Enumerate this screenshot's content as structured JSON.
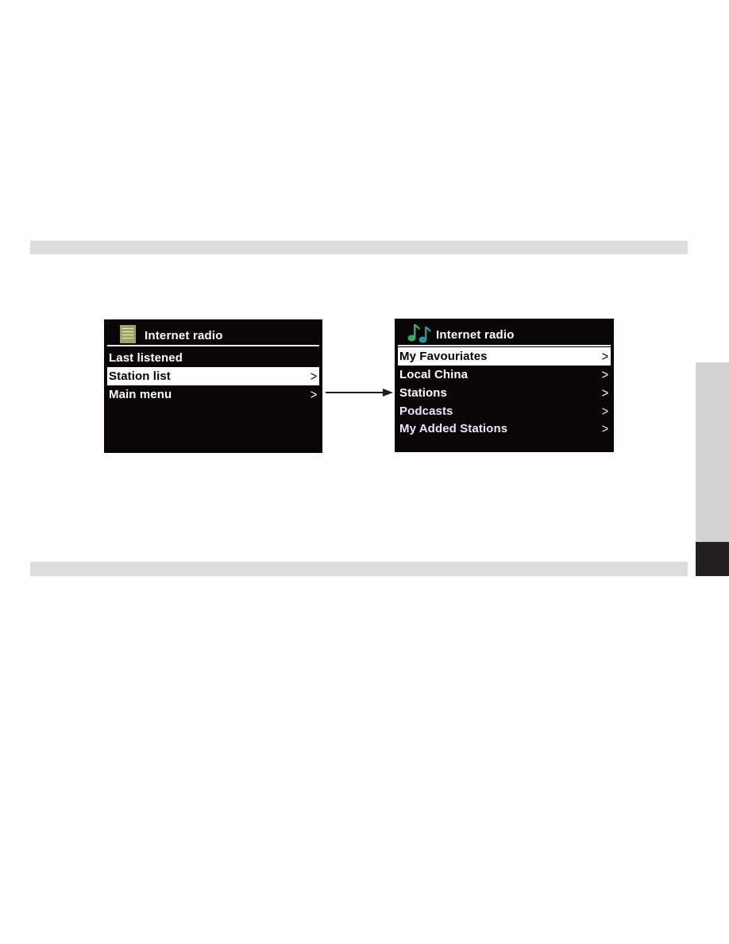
{
  "page": {
    "section_bars": [
      "",
      ""
    ],
    "side_tab": {
      "light_color": "#d3d3d3",
      "dark_color": "#231f20"
    }
  },
  "screens": [
    {
      "id": "internet-radio-menu",
      "icon": "menu-list-icon",
      "title": "Internet radio",
      "items": [
        {
          "label": "Last listened",
          "chevron": "",
          "selected": false
        },
        {
          "label": "Station list",
          "chevron": ">",
          "selected": true
        },
        {
          "label": "Main menu",
          "chevron": ">",
          "selected": false
        }
      ]
    },
    {
      "id": "station-list-menu",
      "icon": "music-notes-icon",
      "title": "Internet radio",
      "items": [
        {
          "label": "My Favouriates",
          "chevron": ">",
          "selected": true
        },
        {
          "label": "Local China",
          "chevron": ">",
          "selected": false
        },
        {
          "label": "Stations",
          "chevron": ">",
          "selected": false
        },
        {
          "label": "Podcasts",
          "chevron": ">",
          "selected": false
        },
        {
          "label": "My Added Stations",
          "chevron": ">",
          "selected": false
        }
      ]
    }
  ],
  "colors": {
    "screen_bg": "#0a0506",
    "selection_bg": "#ffffff",
    "menu_icon": "#9aa566",
    "music_note_a": "#3aa86a",
    "music_note_b": "#2e8fa0"
  }
}
